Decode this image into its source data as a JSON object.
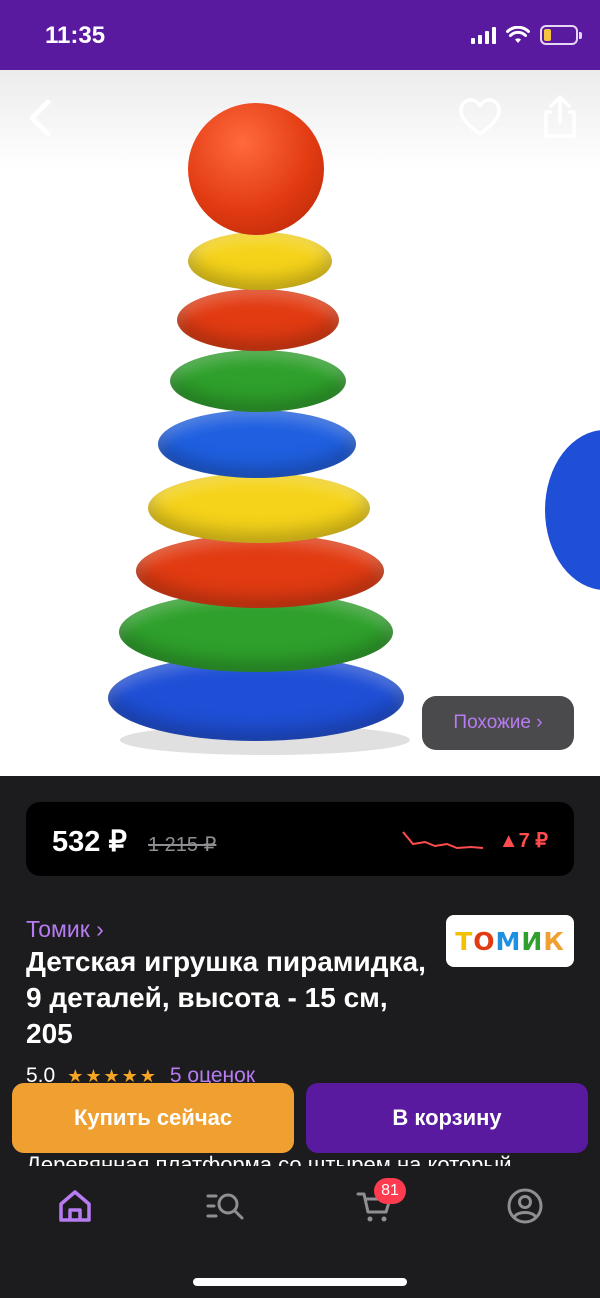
{
  "status_bar": {
    "time": "11:35"
  },
  "gallery": {
    "similar_label": "Похожие ›"
  },
  "price": {
    "current": "532 ₽",
    "old": "1 215 ₽",
    "change": "▲7 ₽",
    "change_color": "#ff4d4d"
  },
  "brand": {
    "link": "Томик ›",
    "logo_text": "ТОМИК"
  },
  "product": {
    "title": "Детская игрушка пирамидка, 9 деталей, высота - 15 см, 205",
    "rating_value": "5.0",
    "rating_stars": "★★★★★",
    "rating_count": "5 оценок",
    "description_peek": "Деревянная платформа со штырем на который"
  },
  "actions": {
    "buy_now": "Купить сейчас",
    "add_to_cart": "В корзину"
  },
  "tab_bar": {
    "cart_badge": "81"
  },
  "colors": {
    "accent": "#5a1aa0",
    "link": "#b77bf2",
    "buy": "#f0a030",
    "badge": "#ff3b4f"
  }
}
